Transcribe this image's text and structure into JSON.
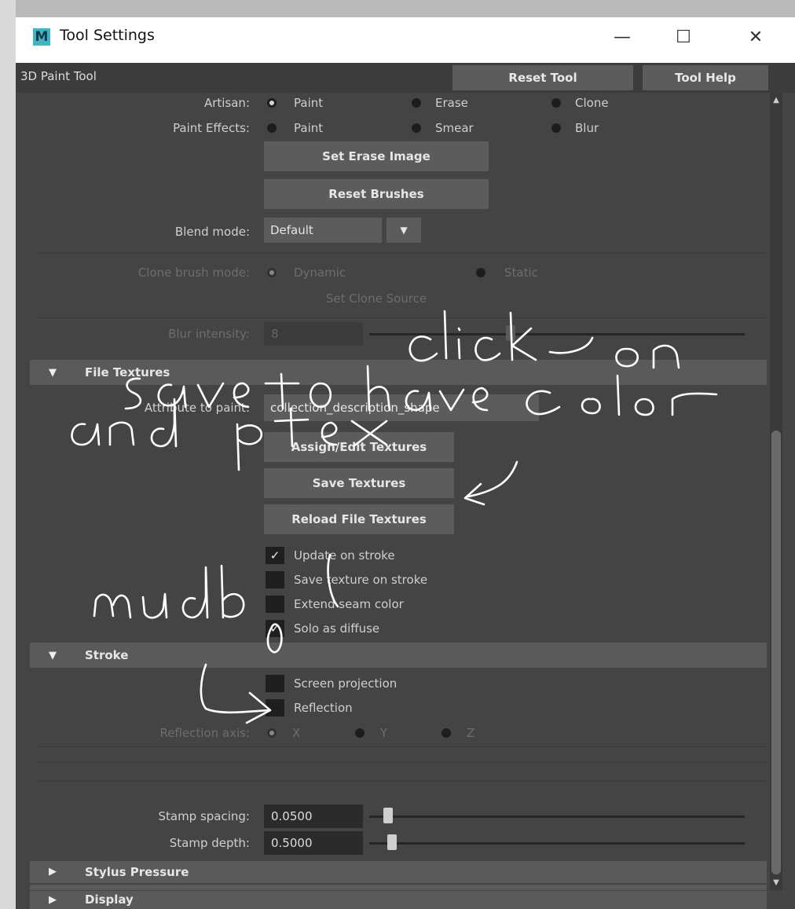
{
  "window": {
    "title": "Tool Settings",
    "logo_letter": "M",
    "controls": {
      "minimize": "—",
      "maximize": "☐",
      "close": "✕"
    }
  },
  "tool_header": {
    "name": "3D Paint Tool",
    "reset_label": "Reset Tool",
    "help_label": "Tool Help"
  },
  "artisan": {
    "label": "Artisan:",
    "options": [
      "Paint",
      "Erase",
      "Clone"
    ],
    "selected": "Paint"
  },
  "paint_effects": {
    "label": "Paint Effects:",
    "options": [
      "Paint",
      "Smear",
      "Blur"
    ]
  },
  "buttons": {
    "set_erase_image": "Set Erase Image",
    "reset_brushes": "Reset Brushes"
  },
  "blend_mode": {
    "label": "Blend mode:",
    "value": "Default"
  },
  "clone_brush_mode": {
    "label": "Clone brush mode:",
    "options": [
      "Dynamic",
      "Static"
    ],
    "selected": "Dynamic",
    "source_button": "Set Clone Source"
  },
  "blur_intensity": {
    "label": "Blur intensity:",
    "value": "8"
  },
  "file_textures": {
    "title": "File Textures",
    "attribute_label": "Attribute to paint:",
    "attribute_value": "collection_description_shape",
    "assign_label": "Assign/Edit Textures",
    "save_label": "Save Textures",
    "reload_label": "Reload File Textures",
    "checkboxes": [
      {
        "label": "Update on stroke",
        "checked": true
      },
      {
        "label": "Save texture on stroke",
        "checked": false
      },
      {
        "label": "Extend seam color",
        "checked": false
      },
      {
        "label": "Solo as diffuse",
        "checked": true
      }
    ]
  },
  "stroke": {
    "title": "Stroke",
    "screen_projection": "Screen projection",
    "reflection": "Reflection",
    "reflection_axis_label": "Reflection axis:",
    "axes": [
      "X",
      "Y",
      "Z"
    ],
    "selected_axis": "X"
  },
  "stamp_spacing": {
    "label": "Stamp spacing:",
    "value": "0.0500",
    "level": 0.05
  },
  "stamp_depth": {
    "label": "Stamp depth:",
    "value": "0.5000",
    "level": 0.06
  },
  "collapsed_sections": [
    "Stylus Pressure",
    "Display"
  ],
  "annotations": {
    "note_1": "click on",
    "note_2": "save to have color and ptex",
    "note_3": "mudbl"
  },
  "colors": {
    "panel_bg": "#444444",
    "button_bg": "#5c5c5c",
    "section_bg": "#5a5a5a",
    "logo_teal": "#3fb5c4",
    "annotation_ink": "#ffffff"
  }
}
